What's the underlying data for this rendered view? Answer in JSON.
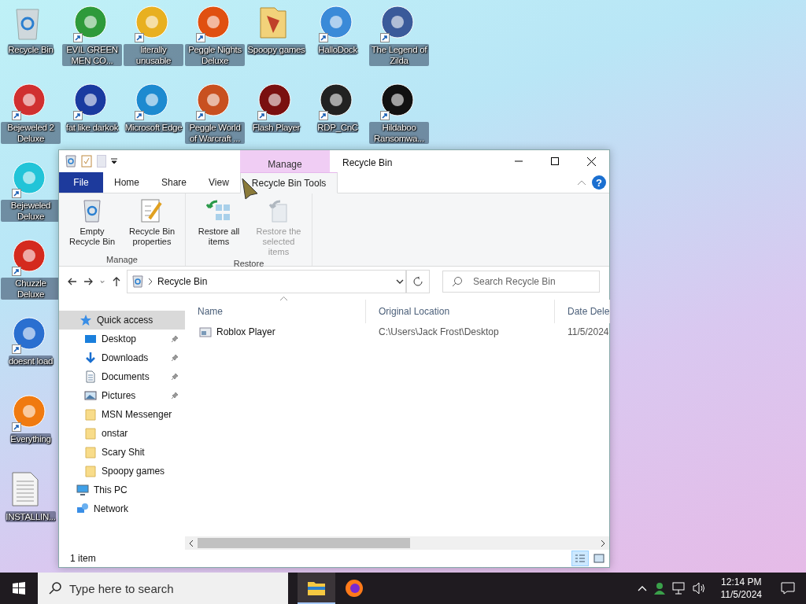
{
  "desktop_columns": [
    [
      {
        "label": "Recycle Bin",
        "kind": "recycle-bin",
        "shortcut": false,
        "color": "#cfd8dc"
      },
      {
        "label": "Bejeweled 2 Deluxe",
        "kind": "app",
        "shortcut": true,
        "color": "#d03030"
      },
      {
        "label": "Bejeweled Deluxe",
        "kind": "app",
        "shortcut": true,
        "color": "#22c4d8"
      },
      {
        "label": "Chuzzle Deluxe",
        "kind": "app",
        "shortcut": true,
        "color": "#d42a1e"
      },
      {
        "label": "doesnt load",
        "kind": "app",
        "shortcut": true,
        "color": "#2a6fd0"
      },
      {
        "label": "Everything",
        "kind": "app",
        "shortcut": true,
        "color": "#f07a10"
      },
      {
        "label": "INSTALLIN...",
        "kind": "document",
        "shortcut": false,
        "color": "#f4f4f4"
      }
    ],
    [
      {
        "label": "EVIL GREEN MEN CO...",
        "kind": "app",
        "shortcut": true,
        "color": "#2e9a3a"
      },
      {
        "label": "fat like darkok",
        "kind": "app",
        "shortcut": true,
        "color": "#1a3aa0"
      }
    ],
    [
      {
        "label": "literally unusable",
        "kind": "app",
        "shortcut": true,
        "color": "#e8b020"
      },
      {
        "label": "Microsoft Edge",
        "kind": "app",
        "shortcut": true,
        "color": "#1d8ad0"
      }
    ],
    [
      {
        "label": "Peggle Nights Deluxe",
        "kind": "app",
        "shortcut": true,
        "color": "#e05010"
      },
      {
        "label": "Peggle World of Warcraft ...",
        "kind": "app",
        "shortcut": true,
        "color": "#c85020"
      }
    ],
    [
      {
        "label": "Spoopy games",
        "kind": "folder",
        "shortcut": false,
        "color": "#f2d27a"
      },
      {
        "label": "Flash Player",
        "kind": "app",
        "shortcut": true,
        "color": "#7a1010"
      }
    ],
    [
      {
        "label": "HalloDock",
        "kind": "app",
        "shortcut": true,
        "color": "#3a8ad8"
      },
      {
        "label": "RDP_CnC",
        "kind": "app",
        "shortcut": true,
        "color": "#222222"
      }
    ],
    [
      {
        "label": "The Legend of Zilda",
        "kind": "app",
        "shortcut": true,
        "color": "#3a5a9a"
      },
      {
        "label": "Hildaboo Ransomwa...",
        "kind": "app",
        "shortcut": true,
        "color": "#111111"
      }
    ]
  ],
  "window": {
    "title": "Recycle Bin",
    "context_group": "Manage",
    "tabs": [
      {
        "label": "File",
        "kind": "file",
        "selected": false
      },
      {
        "label": "Home",
        "kind": "tab",
        "selected": false
      },
      {
        "label": "Share",
        "kind": "tab",
        "selected": false
      },
      {
        "label": "View",
        "kind": "tab",
        "selected": false
      },
      {
        "label": "Recycle Bin Tools",
        "kind": "context",
        "selected": true
      }
    ],
    "help": "?",
    "ribbon_groups": [
      {
        "label": "Manage",
        "buttons": [
          {
            "label": "Empty Recycle Bin",
            "kind": "empty",
            "disabled": false
          },
          {
            "label": "Recycle Bin properties",
            "kind": "properties",
            "disabled": false
          }
        ]
      },
      {
        "label": "Restore",
        "buttons": [
          {
            "label": "Restore all items",
            "kind": "restore-all",
            "disabled": false
          },
          {
            "label": "Restore the selected items",
            "kind": "restore-selected",
            "disabled": true
          }
        ]
      }
    ],
    "address": {
      "location": "Recycle Bin"
    },
    "search": {
      "placeholder": "Search Recycle Bin"
    },
    "navigation": [
      {
        "label": "Quick access",
        "kind": "star",
        "selected": true,
        "children": [
          {
            "label": "Desktop",
            "kind": "desktop",
            "pinned": true,
            "selected": false
          },
          {
            "label": "Downloads",
            "kind": "downloads",
            "pinned": true,
            "selected": false
          },
          {
            "label": "Documents",
            "kind": "documents",
            "pinned": true,
            "selected": false
          },
          {
            "label": "Pictures",
            "kind": "pictures",
            "pinned": true,
            "selected": false
          },
          {
            "label": "MSN Messenger",
            "kind": "folder",
            "pinned": false,
            "selected": false
          },
          {
            "label": "onstar",
            "kind": "folder",
            "pinned": false,
            "selected": false
          },
          {
            "label": "Scary Shit",
            "kind": "folder",
            "pinned": false,
            "selected": false
          },
          {
            "label": "Spoopy games",
            "kind": "folder",
            "pinned": false,
            "selected": false
          }
        ]
      },
      {
        "label": "This PC",
        "kind": "pc",
        "selected": false
      },
      {
        "label": "Network",
        "kind": "network",
        "selected": false
      }
    ],
    "table": {
      "columns": [
        "Name",
        "Original Location",
        "Date Dele"
      ],
      "rows": [
        [
          "Roblox Player",
          "C:\\Users\\Jack Frost\\Desktop",
          "11/5/2024"
        ]
      ]
    },
    "status_bar": "1 item",
    "views": [
      {
        "kind": "details",
        "selected": true
      },
      {
        "kind": "large-icons",
        "selected": false
      }
    ]
  },
  "taskbar": {
    "search_placeholder": "Type here to search",
    "apps": [
      {
        "kind": "explorer",
        "selected": true
      },
      {
        "kind": "firefox",
        "selected": false
      }
    ],
    "time": "12:14 PM",
    "date": "11/5/2024"
  }
}
